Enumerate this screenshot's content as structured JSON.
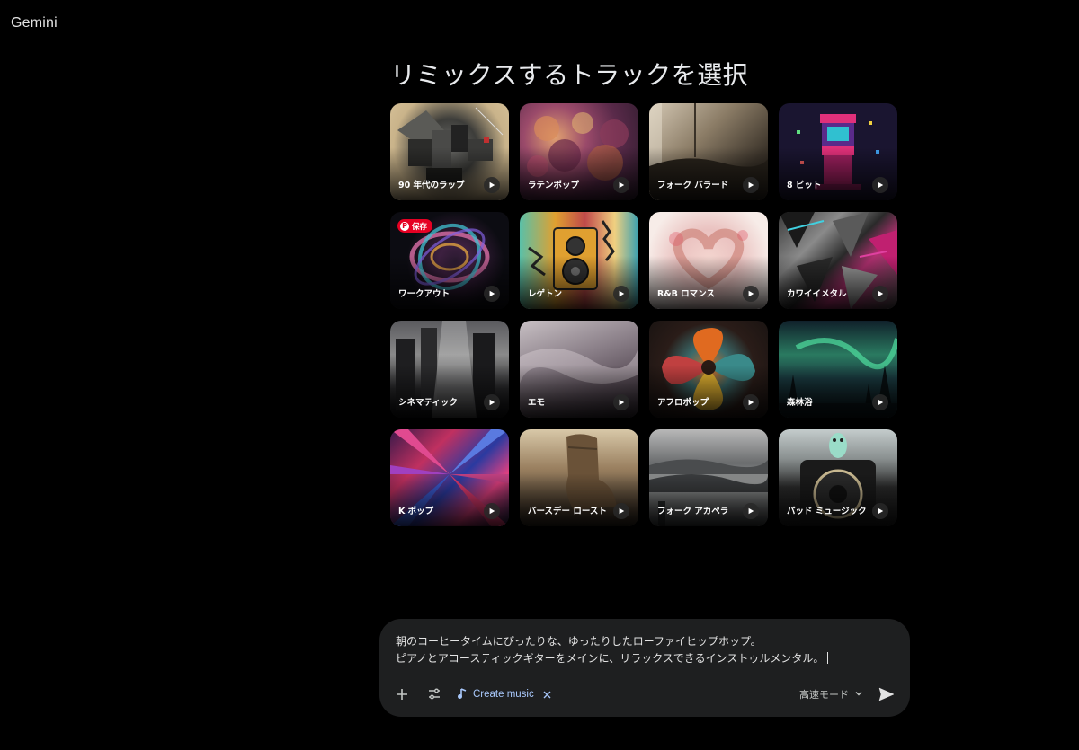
{
  "app": {
    "title": "Gemini"
  },
  "heading": "リミックスするトラックを選択",
  "tracks": [
    {
      "label": "90 年代のラップ"
    },
    {
      "label": "ラテンポップ"
    },
    {
      "label": "フォーク バラード"
    },
    {
      "label": "8 ビット"
    },
    {
      "label": "ワークアウト",
      "badge": "保存"
    },
    {
      "label": "レゲトン"
    },
    {
      "label": "R&B ロマンス"
    },
    {
      "label": "カワイイメタル"
    },
    {
      "label": "シネマティック"
    },
    {
      "label": "エモ"
    },
    {
      "label": "アフロポップ"
    },
    {
      "label": "森林浴"
    },
    {
      "label": "K ポップ"
    },
    {
      "label": "バースデー ロースト"
    },
    {
      "label": "フォーク アカペラ"
    },
    {
      "label": "パッド ミュージック"
    }
  ],
  "composer": {
    "prompt_line1": "朝のコーヒータイムにぴったりな、ゆったりしたローファイヒップホップ。",
    "prompt_line2": "ピアノとアコースティックギターをメインに、リラックスできるインストゥルメンタル。",
    "chip_label": "Create music",
    "mode_label": "高速モード",
    "icons": {
      "add": "plus-icon",
      "tools": "tune-icon",
      "chip": "music-note-icon",
      "chip_close": "close-icon",
      "mode": "chevron-down-icon",
      "send": "send-icon"
    }
  },
  "colors": {
    "background": "#000000",
    "composer": "#1e1f20",
    "accent": "#a8c7fa",
    "pin": "#e60023"
  }
}
